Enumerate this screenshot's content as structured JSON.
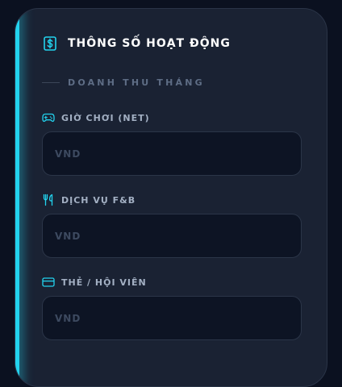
{
  "panel": {
    "title": "THÔNG SỐ HOẠT ĐỘNG",
    "icon": "dollar-icon"
  },
  "section": {
    "label": "DOANH THU THÁNG"
  },
  "fields": [
    {
      "label": "GIỜ CHƠI (NET)",
      "icon": "gamepad-icon",
      "placeholder": "VND",
      "value": ""
    },
    {
      "label": "DỊCH VỤ F&B",
      "icon": "utensils-icon",
      "placeholder": "VND",
      "value": ""
    },
    {
      "label": "THẺ / HỘI VIÊN",
      "icon": "credit-card-icon",
      "placeholder": "VND",
      "value": ""
    }
  ],
  "colors": {
    "accent": "#22d3ee",
    "background": "#0b1120",
    "panel": "#1a2233"
  }
}
